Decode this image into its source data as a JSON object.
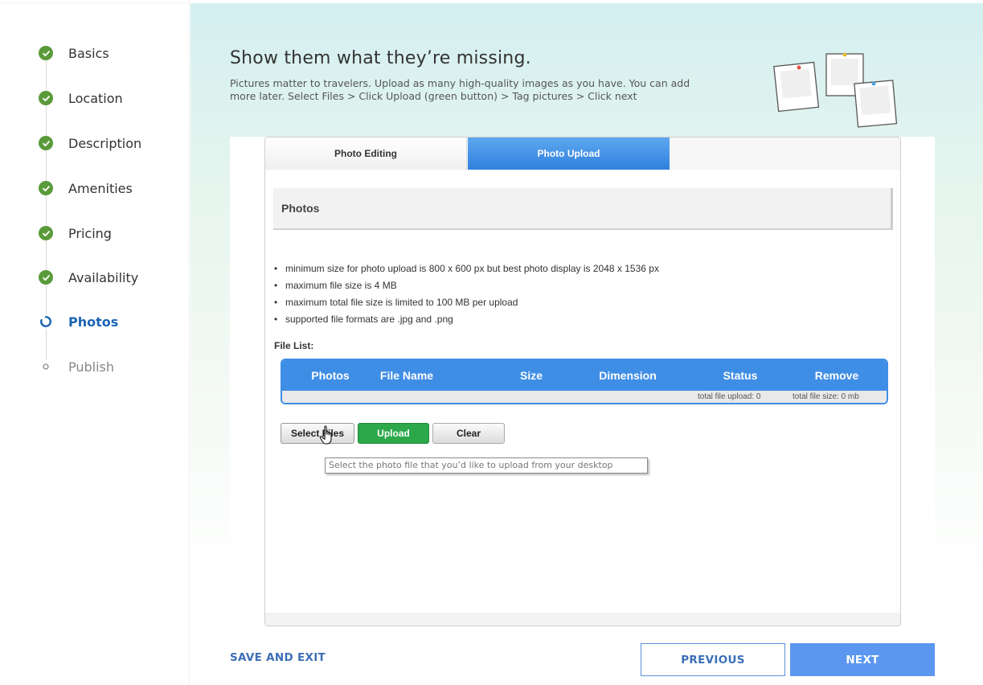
{
  "sidebar": {
    "steps": [
      {
        "label": "Basics",
        "state": "done"
      },
      {
        "label": "Location",
        "state": "done"
      },
      {
        "label": "Description",
        "state": "done"
      },
      {
        "label": "Amenities",
        "state": "done"
      },
      {
        "label": "Pricing",
        "state": "done"
      },
      {
        "label": "Availability",
        "state": "done"
      },
      {
        "label": "Photos",
        "state": "current"
      },
      {
        "label": "Publish",
        "state": "pending"
      }
    ]
  },
  "header": {
    "title": "Show them what they’re missing.",
    "subtitle": "Pictures matter to travelers. Upload as many high-quality images as you have. You can add more later. Select Files > Click Upload (green button) > Tag pictures > Click next"
  },
  "tabs": [
    {
      "label": "Photo Editing",
      "active": false
    },
    {
      "label": "Photo Upload",
      "active": true
    }
  ],
  "section": {
    "title": "Photos"
  },
  "rules": [
    "minimum size for photo upload is 800 x 600 px but best photo display is 2048 x 1536 px",
    "maximum file size is 4 MB",
    "maximum total file size is limited to 100 MB per upload",
    "supported file formats are .jpg and .png"
  ],
  "file_list": {
    "label": "File List:",
    "columns": [
      "Photos",
      "File Name",
      "Size",
      "Dimension",
      "Status",
      "Remove"
    ],
    "total_upload": "total file upload: 0",
    "total_size": "total file size: 0 mb"
  },
  "buttons": {
    "select": "Select Files",
    "upload": "Upload",
    "clear": "Clear"
  },
  "tooltip": "Select the photo file that you’d like to upload from your desktop",
  "footer": {
    "save_exit": "SAVE AND EXIT",
    "previous": "PREVIOUS",
    "next": "NEXT"
  },
  "colors": {
    "done": "#5a9a3a",
    "current": "#1b65b5",
    "tab_active": "#2f80dd",
    "table_header": "#3f8ee6",
    "upload_button": "#2ca84a",
    "next_button": "#5b97f0"
  },
  "icons": {
    "done": "check-circle-icon",
    "current": "progress-ring-icon",
    "pending": "empty-circle-icon",
    "cursor": "hand-pointer-icon",
    "illustration": "polaroid-photos-illustration"
  }
}
